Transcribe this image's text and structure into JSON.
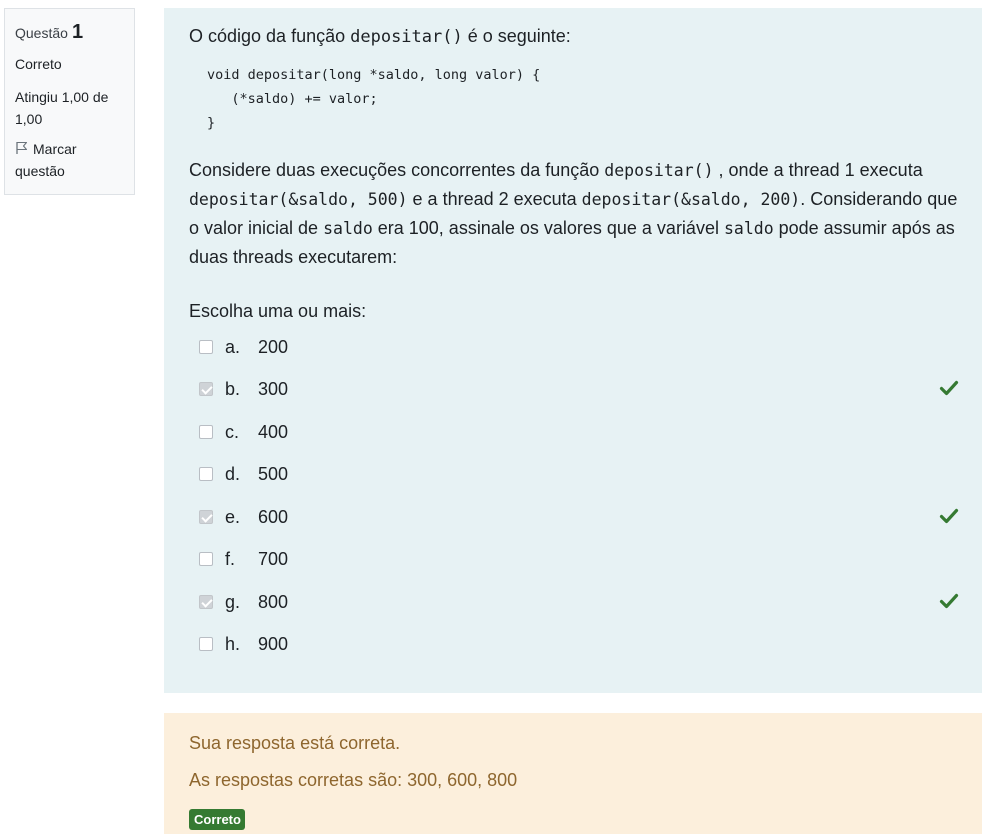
{
  "info": {
    "question_label": "Questão",
    "question_number": "1",
    "state": "Correto",
    "grade": "Atingiu 1,00 de 1,00",
    "flag_label": "Marcar questão"
  },
  "question": {
    "intro_pre": "O código da função ",
    "intro_code": "depositar()",
    "intro_post": " é o seguinte:",
    "code": "void depositar(long *saldo, long valor) {\n   (*saldo) += valor;\n}",
    "stem_1": "Considere duas execuções concorrentes da função ",
    "stem_code_1": "depositar()",
    "stem_2": " , onde a thread 1 executa ",
    "stem_code_2": "depositar(&saldo, 500)",
    "stem_3": " e a thread 2 executa ",
    "stem_code_3": "depositar(&saldo, 200)",
    "stem_4": ". Considerando que o valor inicial de ",
    "stem_code_4": "saldo",
    "stem_5": " era 100, assinale os valores que a variável ",
    "stem_code_5": "saldo",
    "stem_6": " pode assumir após as duas threads executarem:",
    "prompt": "Escolha uma ou mais:"
  },
  "options": [
    {
      "letter": "a.",
      "text": "200",
      "checked": false,
      "correct_mark": false
    },
    {
      "letter": "b.",
      "text": "300",
      "checked": true,
      "correct_mark": true
    },
    {
      "letter": "c.",
      "text": "400",
      "checked": false,
      "correct_mark": false
    },
    {
      "letter": "d.",
      "text": "500",
      "checked": false,
      "correct_mark": false
    },
    {
      "letter": "e.",
      "text": "600",
      "checked": true,
      "correct_mark": true
    },
    {
      "letter": "f.",
      "text": "700",
      "checked": false,
      "correct_mark": false
    },
    {
      "letter": "g.",
      "text": "800",
      "checked": true,
      "correct_mark": true
    },
    {
      "letter": "h.",
      "text": "900",
      "checked": false,
      "correct_mark": false
    }
  ],
  "feedback": {
    "result": "Sua resposta está correta.",
    "right_answer": "As respostas corretas são: 300, 600, 800",
    "badge": "Correto"
  },
  "colors": {
    "question_bg": "#e7f2f4",
    "feedback_bg": "#fcefdc",
    "feedback_text": "#8e662e",
    "correct_green": "#357a32"
  }
}
